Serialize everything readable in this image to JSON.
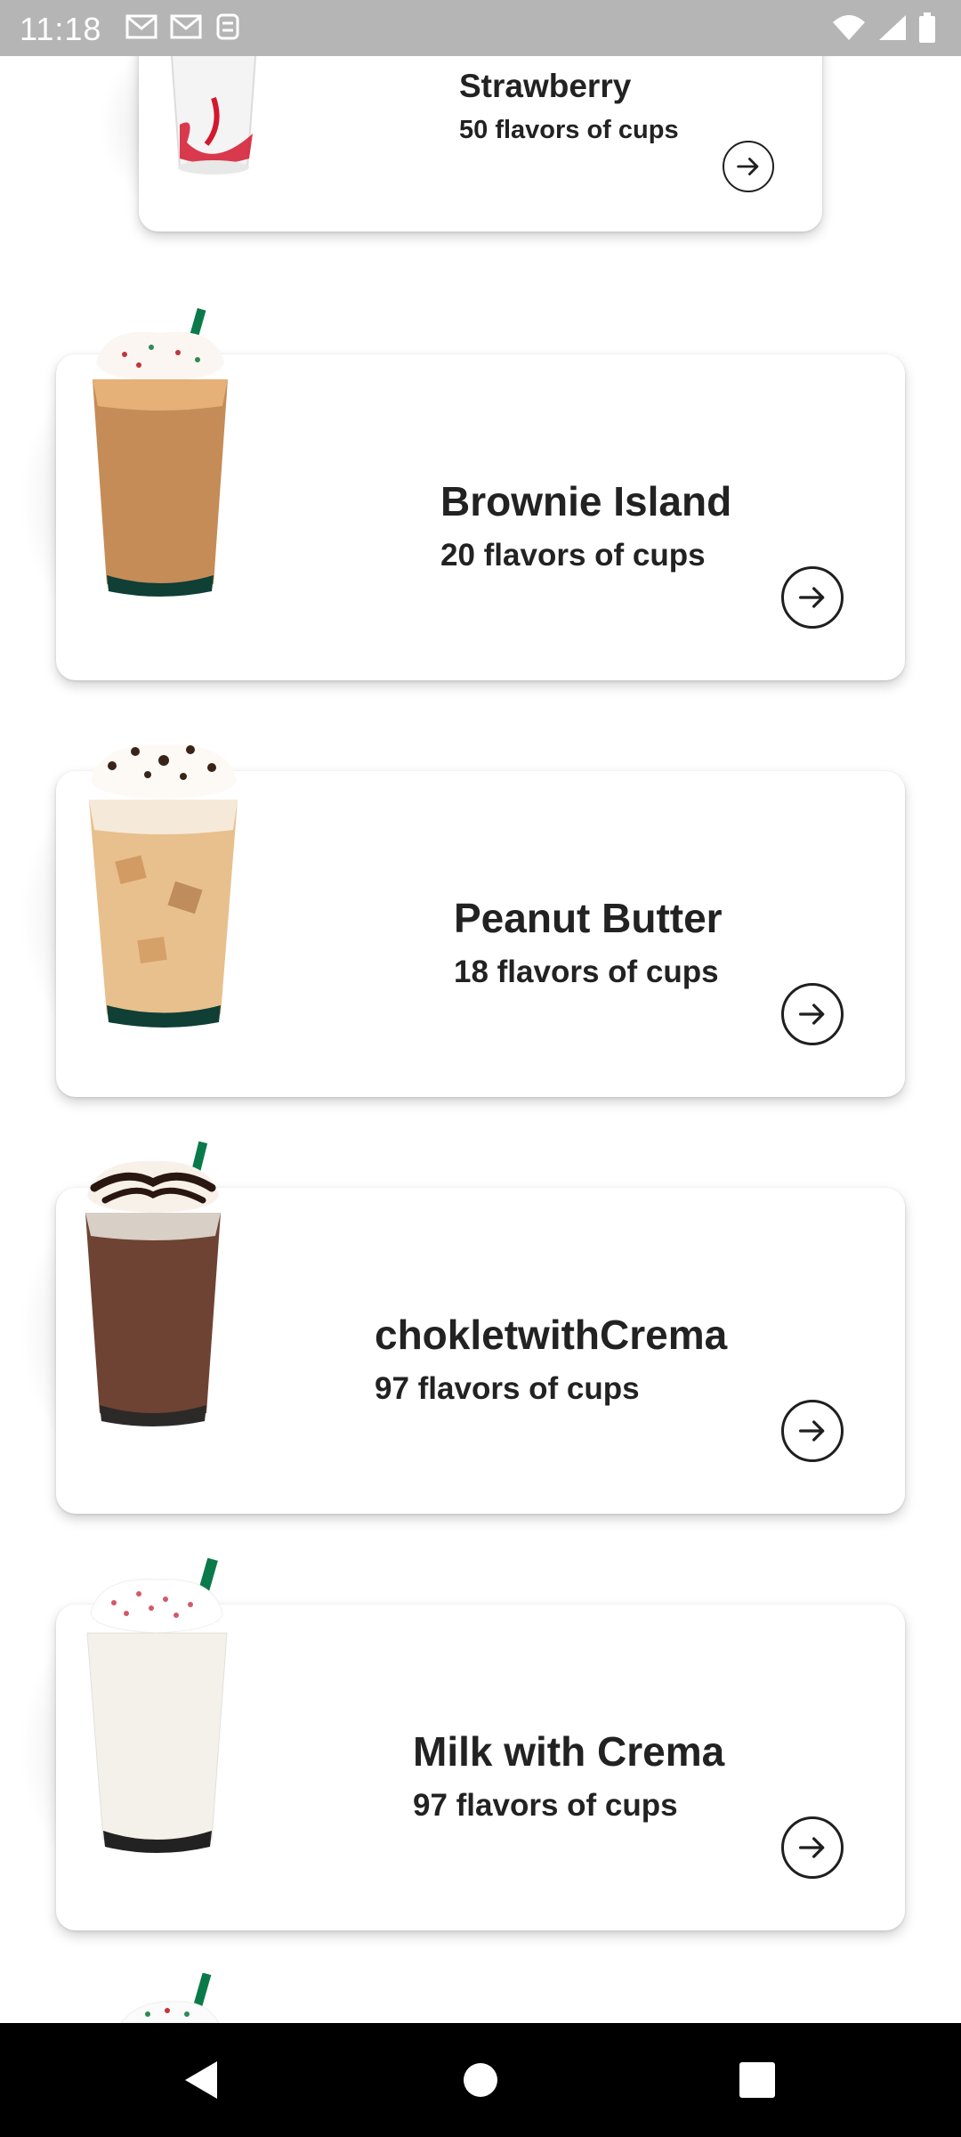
{
  "status_bar": {
    "time": "11:18",
    "left_icons": [
      "gmail-icon",
      "gmail-icon",
      "sync-icon"
    ],
    "right_icons": [
      "wifi-icon",
      "signal-icon",
      "battery-icon"
    ]
  },
  "products": [
    {
      "title": "Strawberry",
      "subtitle": "50 flavors of cups",
      "image": "strawberry-frappuccino",
      "cream": "#ffffff",
      "drink": "#f4f4f4",
      "accent": "#d3182e"
    },
    {
      "title": "Brownie Island",
      "subtitle": "20 flavors of cups",
      "image": "caramel-frappuccino",
      "cream": "#fbf6f1",
      "drink": "#c58c57",
      "accent": "#0b7a4a"
    },
    {
      "title": "Peanut Butter",
      "subtitle": "18 flavors of cups",
      "image": "iced-latte-chocolate",
      "cream": "#fdfaf6",
      "drink": "#e8c08d",
      "accent": "#3a2418"
    },
    {
      "title": "chokletwithCrema",
      "subtitle": "97 flavors of cups",
      "image": "mocha-frappuccino",
      "cream": "#f7f1ea",
      "drink": "#6e4333",
      "accent": "#0b7a4a"
    },
    {
      "title": "Milk with Crema",
      "subtitle": "97 flavors of cups",
      "image": "vanilla-frappuccino",
      "cream": "#ffffff",
      "drink": "#f3f1ea",
      "accent": "#0b7a4a"
    }
  ],
  "nav": {
    "back": "back-icon",
    "home": "home-icon",
    "recents": "recents-icon"
  }
}
